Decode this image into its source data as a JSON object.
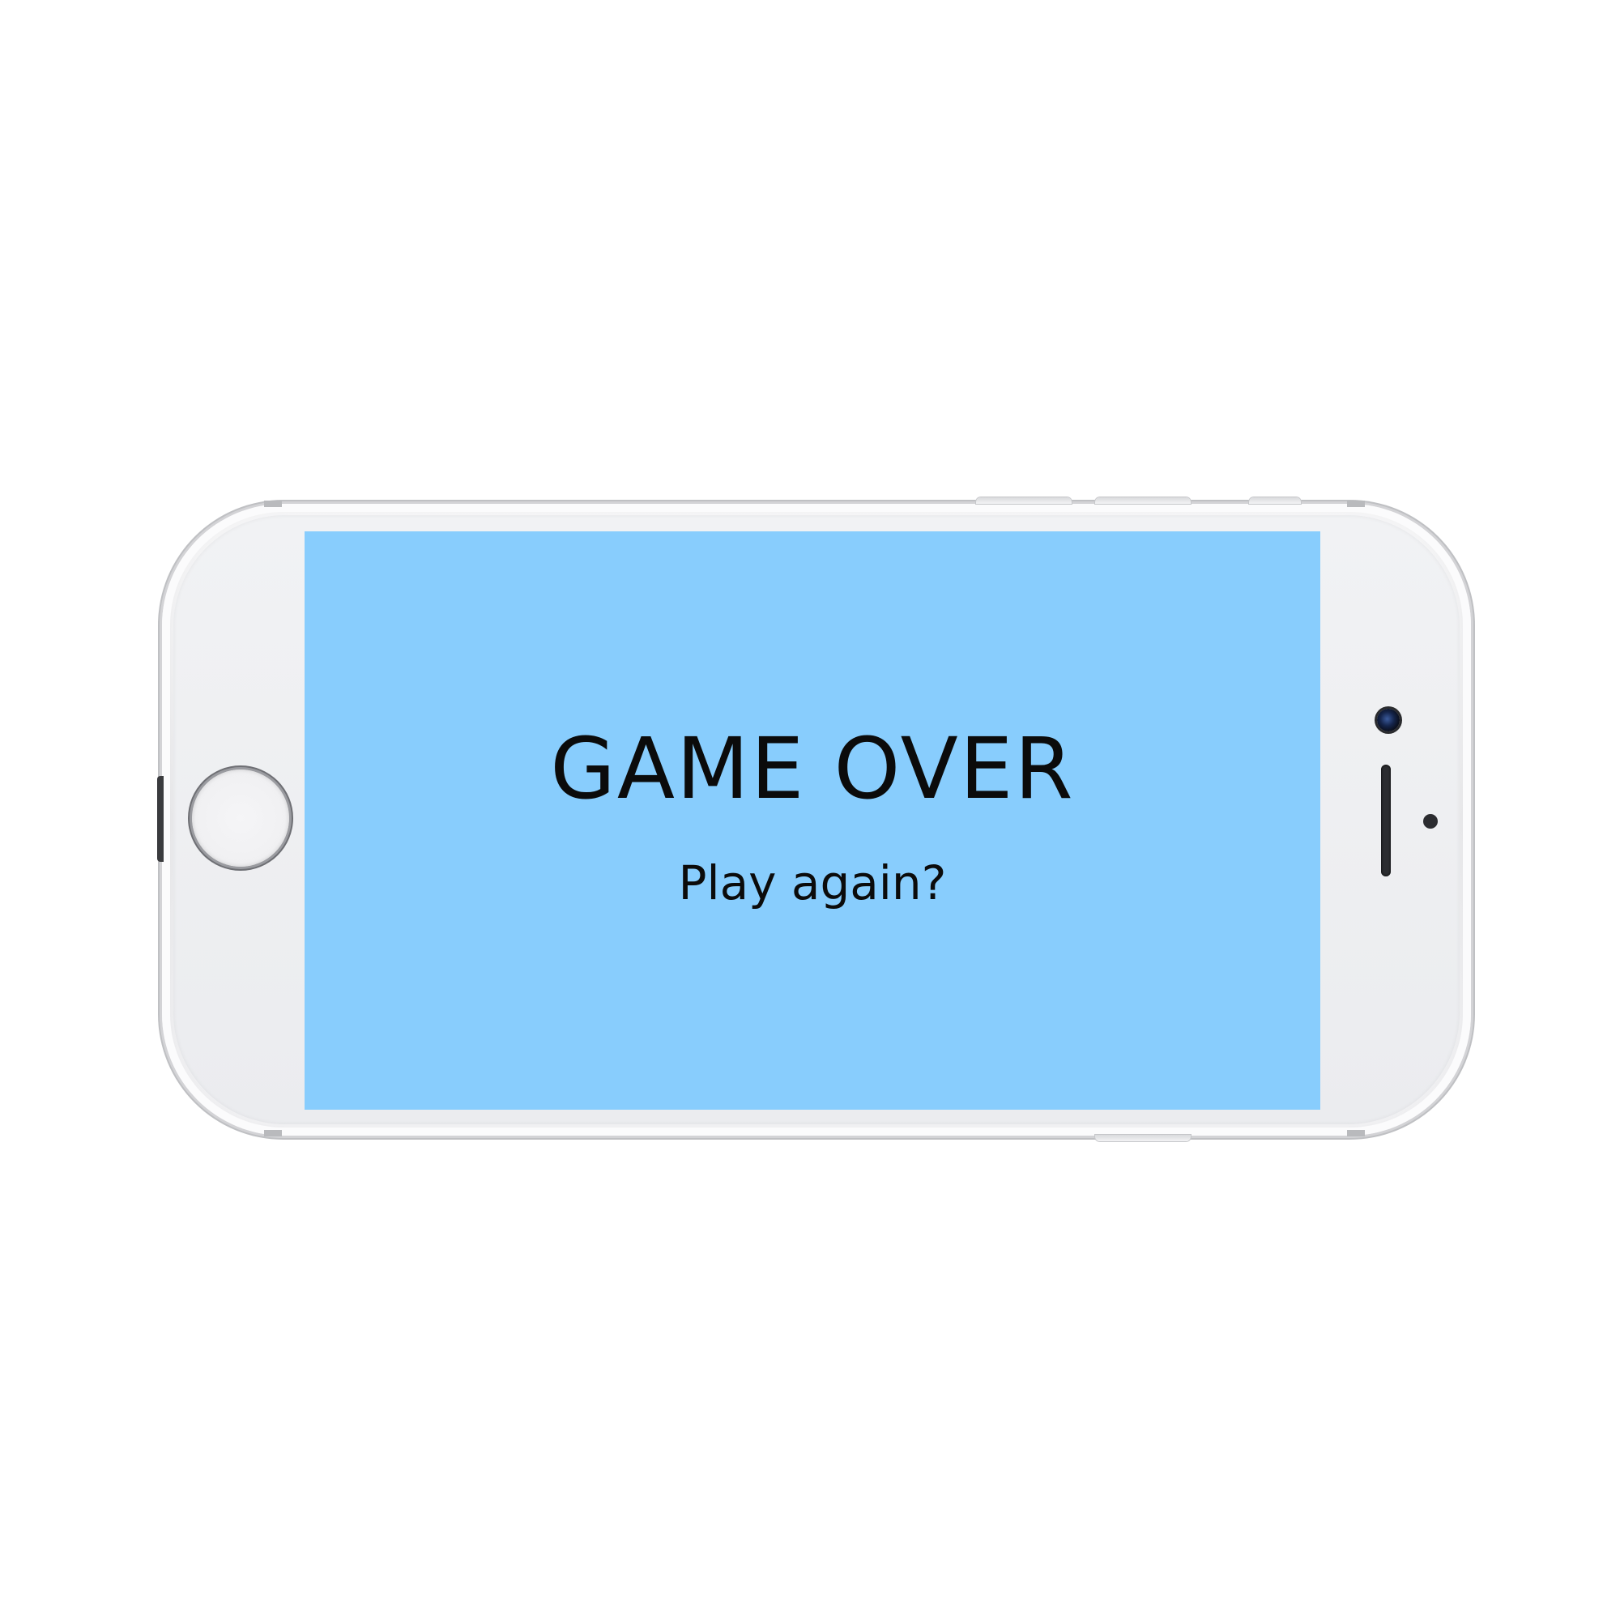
{
  "game": {
    "title": "GAME OVER",
    "prompt": "Play again?"
  },
  "colors": {
    "screen_background": "#88cdfd",
    "text": "#0b0b0b",
    "device_body": "#eeeff1"
  },
  "device": {
    "orientation": "landscape",
    "icons": [
      "home-button",
      "front-camera-icon",
      "earpiece-speaker-icon",
      "proximity-sensor-icon"
    ]
  }
}
